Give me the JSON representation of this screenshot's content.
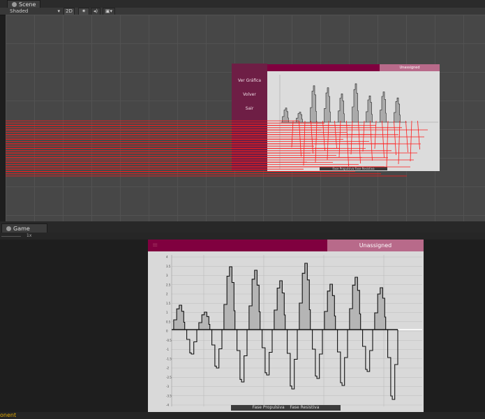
{
  "scene_window": {
    "tab_label": "Scene",
    "shading_mode": "Shaded",
    "mode_2d": "2D",
    "icons": [
      "scene-icon",
      "chevron-down-icon",
      "sun-icon",
      "audio-icon",
      "image-icon"
    ],
    "menu": {
      "items": [
        "Ver Gráfica",
        "Volver",
        "Sair"
      ]
    },
    "chart_header": {
      "unassigned": "Unassigned"
    },
    "legend": "Fase Propulsiva  Fase Resistiva"
  },
  "game_window": {
    "tab_label": "Game",
    "scale_label": "1x",
    "unassigned": "Unassigned",
    "legend": {
      "propulsive": "Fase Propulsiva",
      "resistive": "Fase Resistiva"
    },
    "y_ticks": [
      "4",
      "3.5",
      "3",
      "2.5",
      "2",
      "1.5",
      "1",
      "0.5",
      "0",
      "-0.5",
      "-1",
      "-1.5",
      "-2",
      "-2.5",
      "-3",
      "-3.5",
      "-4"
    ]
  },
  "console": {
    "text": "onent"
  },
  "colors": {
    "accent": "#80003f",
    "accent_light": "#b86a8a",
    "panel": "#6e1e45",
    "debug_lines": "#ff1a1a"
  }
}
